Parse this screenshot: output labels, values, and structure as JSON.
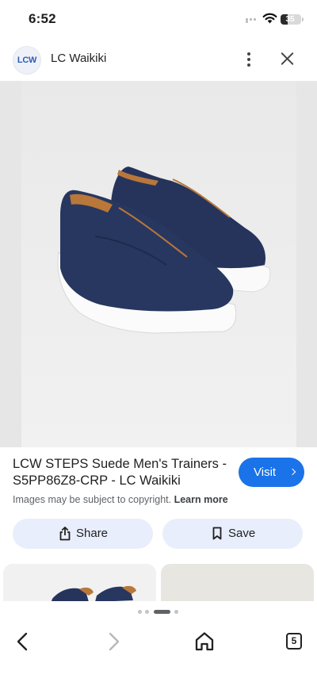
{
  "status_bar": {
    "time": "6:52",
    "battery_level": "35",
    "battery_fraction": 0.35
  },
  "site": {
    "logo_text": "LCW",
    "name": "LC Waikiki",
    "more_icon": "more-vert-icon",
    "close_icon": "close-icon"
  },
  "product": {
    "title": "LCW STEPS Suede Men's Trainers - S5PP86Z8-CRP - LC Waikiki",
    "image_description_icon": "product-photo",
    "visit_label": "Visit",
    "copyright_text": "Images may be subject to copyright.",
    "learn_more_label": "Learn more"
  },
  "actions": {
    "share_label": "Share",
    "save_label": "Save"
  },
  "toolbar": {
    "tabs_count": "5",
    "back_icon": "chevron-left-icon",
    "forward_icon": "chevron-right-icon",
    "home_icon": "home-icon"
  },
  "colors": {
    "accent": "#1a73e8",
    "pill_background": "#e8eefb",
    "shoe_navy": "#27365f",
    "shoe_lining": "#b9773a"
  }
}
